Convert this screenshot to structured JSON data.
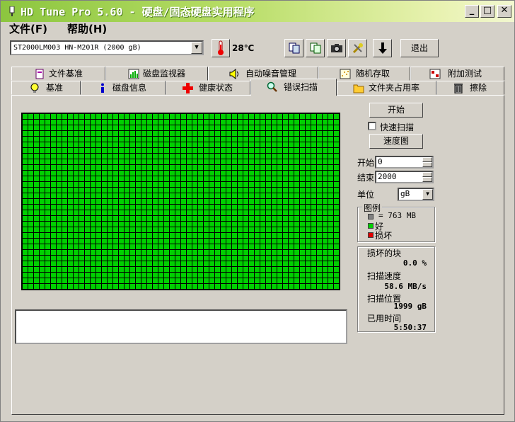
{
  "window": {
    "title": "HD Tune Pro 5.60 - 硬盘/固态硬盘实用程序"
  },
  "menu": {
    "file": "文件(F)",
    "help": "帮助(H)"
  },
  "toolbar": {
    "drive": "ST2000LM003 HN-M201R (2000 gB)",
    "temperature": "28℃",
    "exit_label": "退出"
  },
  "tabs": {
    "row1": [
      "文件基准",
      "磁盘监视器",
      "自动噪音管理",
      "随机存取",
      "附加测试"
    ],
    "row2": [
      "基准",
      "磁盘信息",
      "健康状态",
      "错误扫描",
      "文件夹占用率",
      "擦除"
    ]
  },
  "scan": {
    "start_button": "开始",
    "quick_scan_label": "快速扫描",
    "quick_scan_checked": false,
    "speed_map_button": "速度图",
    "start_label": "开始",
    "start_value": "0",
    "end_label": "结束",
    "end_value": "2000",
    "unit_label": "单位",
    "unit_value": "gB"
  },
  "legend": {
    "title": "图例",
    "block_size": "= 763 MB",
    "good": "好",
    "bad": "损坏",
    "colors": {
      "block": "#808080",
      "good": "#00d000",
      "bad": "#e00000"
    }
  },
  "stats": {
    "damaged_label": "损坏的块",
    "damaged_value": "0.0 %",
    "speed_label": "扫描速度",
    "speed_value": "58.6 MB/s",
    "position_label": "扫描位置",
    "position_value": "1999 gB",
    "elapsed_label": "已用时间",
    "elapsed_value": "5:50:37"
  },
  "colors": {
    "grid_good": "#00d000",
    "title_gradient_start": "#8cc63f"
  }
}
